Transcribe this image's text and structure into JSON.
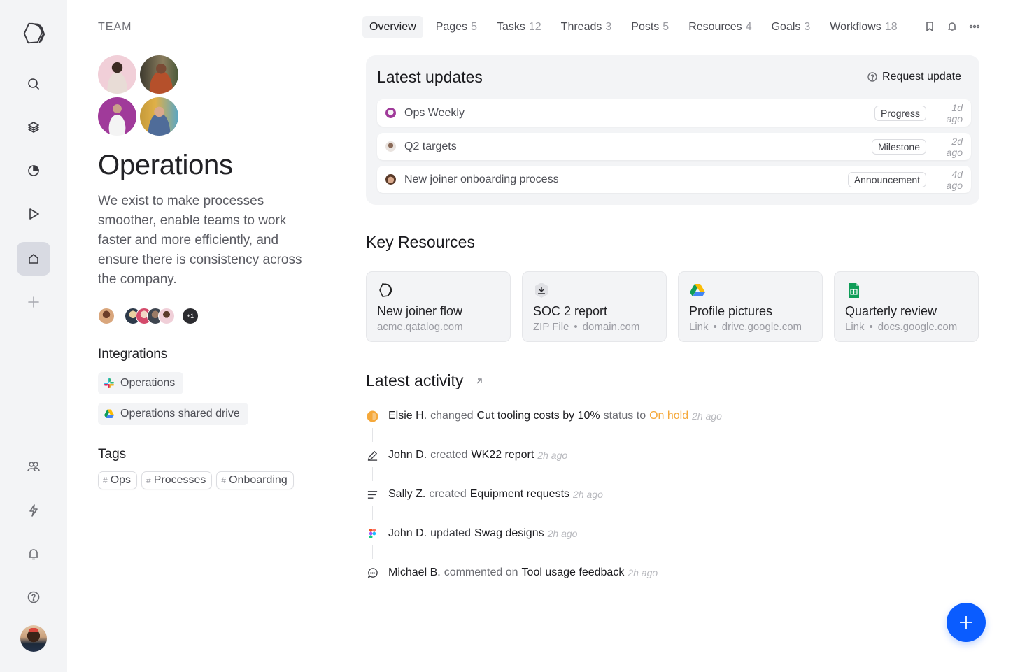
{
  "sidebar": {
    "items": [
      {
        "name": "logo",
        "icon": "qatalog-logo-icon"
      },
      {
        "name": "search",
        "icon": "search-icon"
      },
      {
        "name": "layers",
        "icon": "layers-icon"
      },
      {
        "name": "goals",
        "icon": "pie-chart-icon"
      },
      {
        "name": "workflows",
        "icon": "play-icon"
      },
      {
        "name": "home",
        "icon": "home-icon",
        "active": true
      },
      {
        "name": "add",
        "icon": "plus-icon"
      },
      {
        "name": "people",
        "icon": "people-icon"
      },
      {
        "name": "integrations",
        "icon": "lightning-icon"
      },
      {
        "name": "notifications",
        "icon": "bell-icon"
      },
      {
        "name": "help",
        "icon": "help-icon"
      },
      {
        "name": "profile",
        "icon": "user-avatar"
      }
    ]
  },
  "team": {
    "label": "TEAM",
    "title": "Operations",
    "description": "We exist to make processes smoother, enable teams to work faster and more efficiently, and ensure there is consistency across the company.",
    "members_overflow": "+1"
  },
  "integrations": {
    "heading": "Integrations",
    "items": [
      {
        "label": "Operations",
        "icon": "slack-icon"
      },
      {
        "label": "Operations shared drive",
        "icon": "google-drive-icon"
      }
    ]
  },
  "tags": {
    "heading": "Tags",
    "hash": "#",
    "items": [
      "Ops",
      "Processes",
      "Onboarding"
    ]
  },
  "tabs": [
    {
      "label": "Overview",
      "count": "",
      "active": true
    },
    {
      "label": "Pages",
      "count": "5"
    },
    {
      "label": "Tasks",
      "count": "12"
    },
    {
      "label": "Threads",
      "count": "3"
    },
    {
      "label": "Posts",
      "count": "5"
    },
    {
      "label": "Resources",
      "count": "4"
    },
    {
      "label": "Goals",
      "count": "3"
    },
    {
      "label": "Workflows",
      "count": "18"
    }
  ],
  "updates": {
    "heading": "Latest updates",
    "request_label": "Request update",
    "items": [
      {
        "title": "Ops Weekly",
        "badge": "Progress",
        "time": "1d ago"
      },
      {
        "title": "Q2 targets",
        "badge": "Milestone",
        "time": "2d ago"
      },
      {
        "title": "New joiner onboarding process",
        "badge": "Announcement",
        "time": "4d ago"
      }
    ]
  },
  "resources": {
    "heading": "Key Resources",
    "items": [
      {
        "title": "New joiner flow",
        "type": "",
        "domain": "acme.qatalog.com",
        "icon": "qatalog-logo-icon"
      },
      {
        "title": "SOC 2 report",
        "type": "ZIP File",
        "domain": "domain.com",
        "icon": "download-icon"
      },
      {
        "title": "Profile pictures",
        "type": "Link",
        "domain": "drive.google.com",
        "icon": "google-drive-icon"
      },
      {
        "title": "Quarterly review",
        "type": "Link",
        "domain": "docs.google.com",
        "icon": "google-sheets-icon"
      }
    ],
    "separator": "•"
  },
  "activity": {
    "heading": "Latest activity",
    "items": [
      {
        "who": "Elsie H.",
        "verb": "changed",
        "object": "Cut tooling costs by 10%",
        "verb2": "status to",
        "status": "On hold",
        "time": "2h ago",
        "icon": "status-on-hold-icon"
      },
      {
        "who": "John D.",
        "verb": "created",
        "object": "WK22 report",
        "time": "2h ago",
        "icon": "pencil-icon"
      },
      {
        "who": "Sally Z.",
        "verb": "created",
        "object": "Equipment requests",
        "time": "2h ago",
        "icon": "text-lines-icon"
      },
      {
        "who": "John D.",
        "verb": "updated",
        "object": "Swag designs",
        "time": "2h ago",
        "icon": "figma-icon"
      },
      {
        "who": "Michael B.",
        "verb": "commented on",
        "object": "Tool usage feedback",
        "time": "2h ago",
        "icon": "comment-icon"
      }
    ]
  },
  "colors": {
    "accent": "#0a5cff",
    "on_hold": "#f5a83a",
    "panel_bg": "#f3f4f6"
  }
}
